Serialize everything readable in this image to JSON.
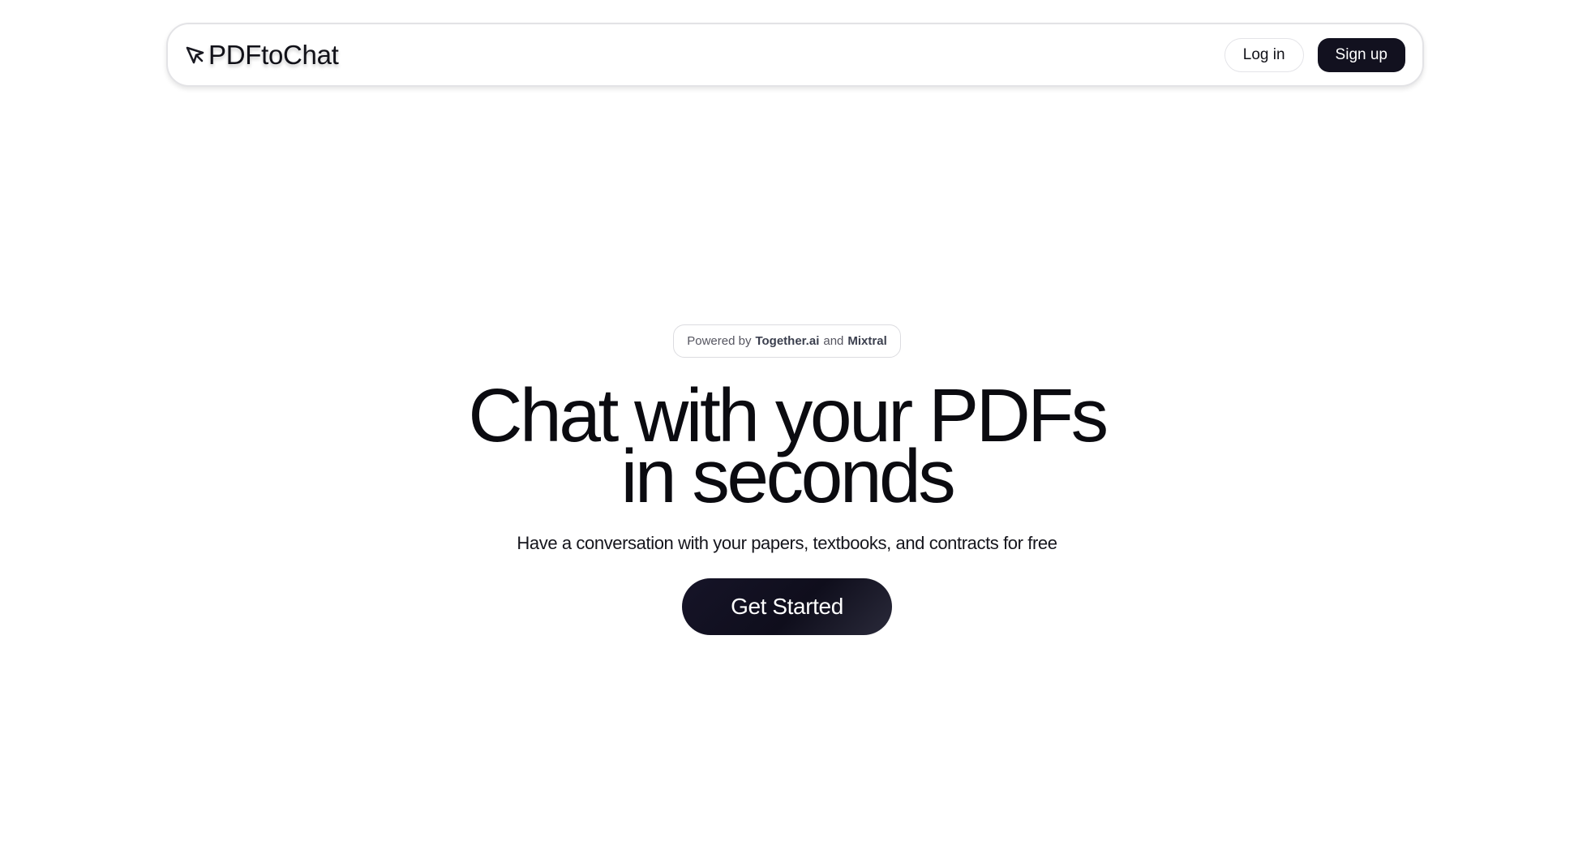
{
  "nav": {
    "brand_name": "PDFtoChat",
    "brand_icon": "cursor-arrow-icon",
    "login_label": "Log in",
    "signup_label": "Sign up"
  },
  "hero": {
    "badge": {
      "prefix": "Powered by",
      "provider": "Together.ai",
      "joiner": "and",
      "model": "Mixtral"
    },
    "headline_line1": "Chat with your PDFs",
    "headline_line2": "in seconds",
    "subheadline": "Have a conversation with your papers, textbooks, and contracts for free",
    "cta_label": "Get Started"
  },
  "colors": {
    "primary_dark": "#12111f",
    "text": "#0b0b10",
    "badge_bold": "#3b3f4e",
    "border": "#e3e3e6"
  }
}
